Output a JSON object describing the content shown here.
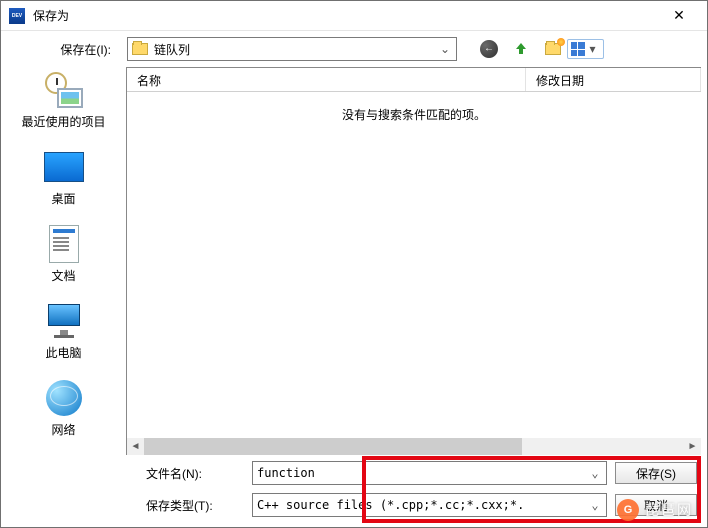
{
  "window": {
    "title": "保存为"
  },
  "toolbar": {
    "save_in_label": "保存在(I):",
    "location_name": "链队列"
  },
  "nav_icons": {
    "back": "back-icon",
    "up": "up-one-level-icon",
    "new_folder": "new-folder-icon",
    "view_menu": "view-menu-icon"
  },
  "places": [
    {
      "key": "recent",
      "label": "最近使用的项目"
    },
    {
      "key": "desktop",
      "label": "桌面"
    },
    {
      "key": "documents",
      "label": "文档"
    },
    {
      "key": "this_pc",
      "label": "此电脑"
    },
    {
      "key": "network",
      "label": "网络"
    }
  ],
  "columns": {
    "name": "名称",
    "date": "修改日期"
  },
  "list": {
    "empty_message": "没有与搜索条件匹配的项。"
  },
  "fields": {
    "filename_label": "文件名(N):",
    "filename_value": "function",
    "filetype_label": "保存类型(T):",
    "filetype_value": "C++ source files (*.cpp;*.cc;*.cxx;*."
  },
  "buttons": {
    "save": "保存(S)",
    "cancel": "取消"
  },
  "watermark": {
    "badge": "G",
    "text": "琵琶网"
  }
}
